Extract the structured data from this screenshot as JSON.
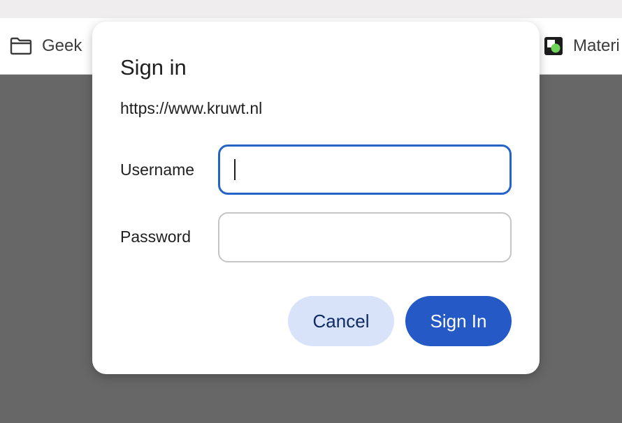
{
  "bookmarks_bar": {
    "items": [
      {
        "label": "Geek",
        "icon": "folder-icon"
      },
      {
        "label": "Materi",
        "icon": "materialize-favicon-icon"
      }
    ]
  },
  "dialog": {
    "title": "Sign in",
    "url": "https://www.kruwt.nl",
    "username_label": "Username",
    "username_value": "",
    "password_label": "Password",
    "password_value": "",
    "cancel_label": "Cancel",
    "signin_label": "Sign In"
  },
  "colors": {
    "backdrop": "#676767",
    "focus_border": "#2563c7",
    "primary_button": "#2459c6",
    "secondary_button": "#d8e3f9"
  }
}
